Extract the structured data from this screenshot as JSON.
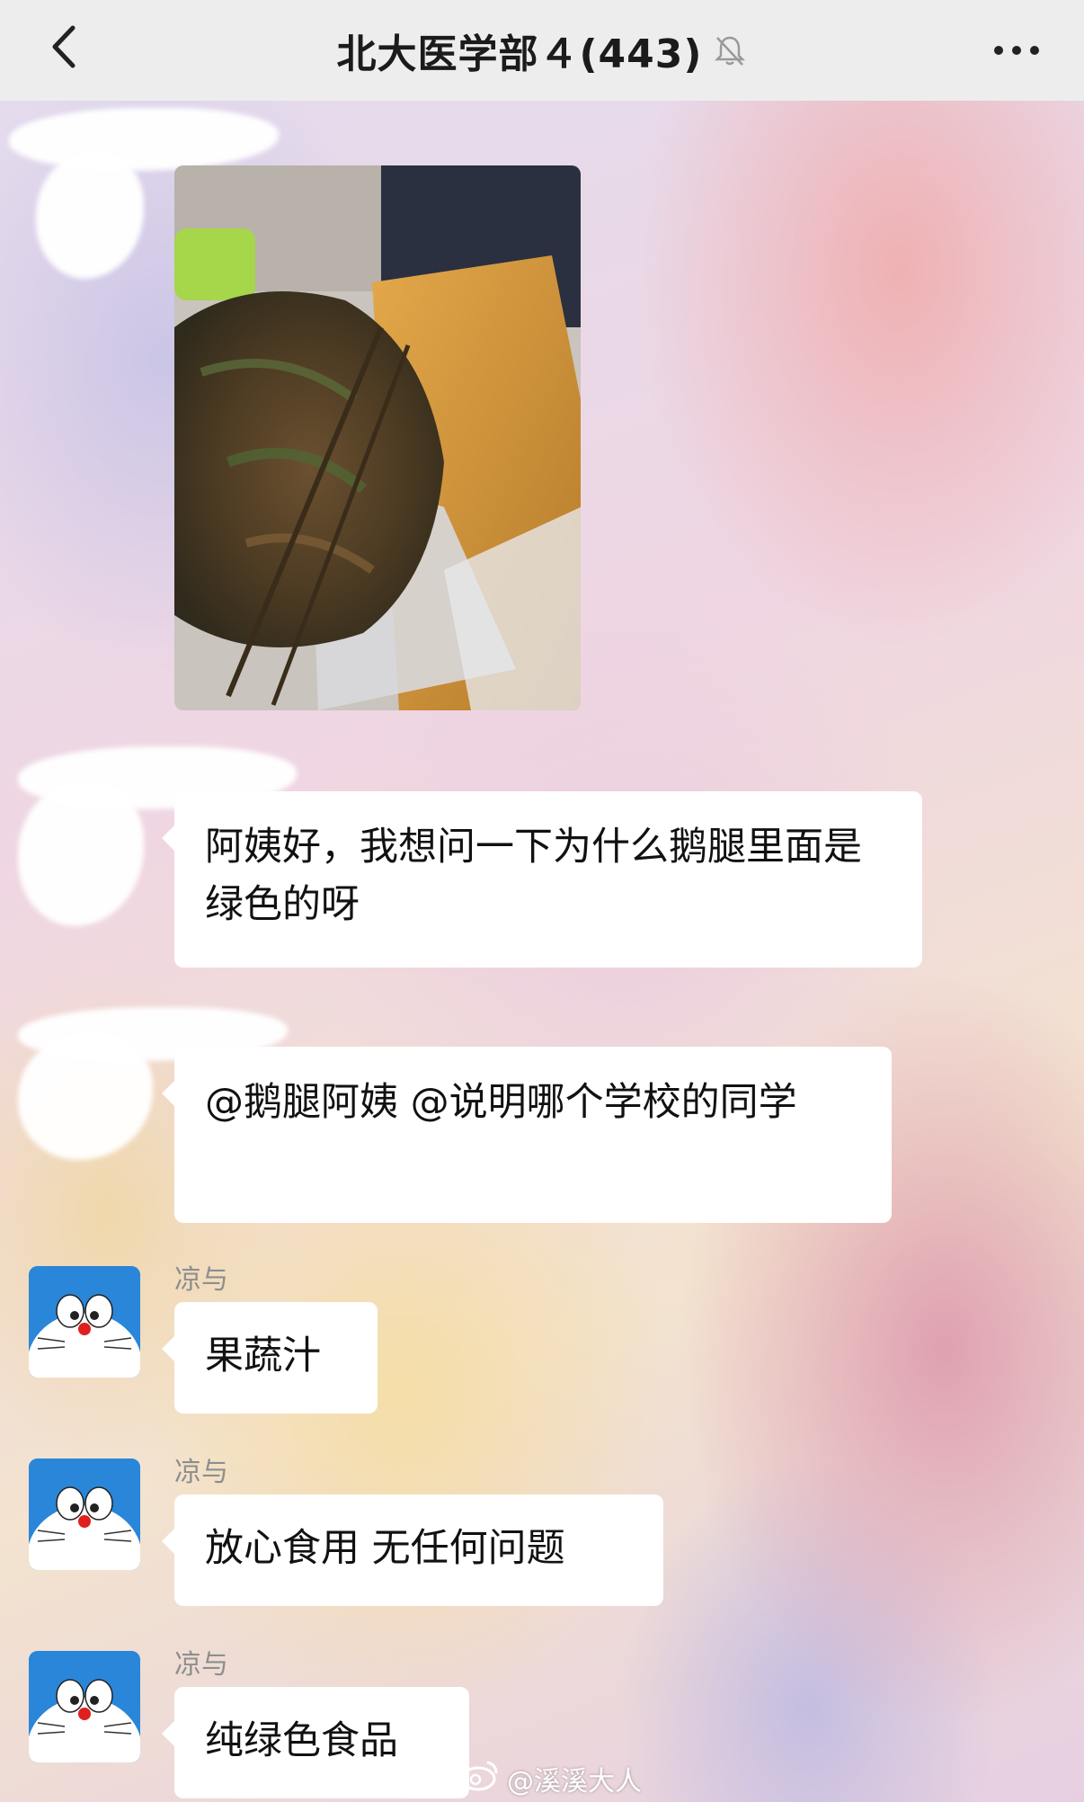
{
  "header": {
    "title": "北大医学部４(443)",
    "back_icon": "chevron-left-icon",
    "mute_icon": "bell-muted-icon",
    "more_icon": "more-dots-icon"
  },
  "messages": [
    {
      "type": "image",
      "sender_redacted": true,
      "image_desc": "goose-leg-photo"
    },
    {
      "type": "text",
      "sender_redacted": true,
      "text": "阿姨好，我想问一下为什么鹅腿里面是绿色的呀"
    },
    {
      "type": "text",
      "sender_redacted": true,
      "text": "@鹅腿阿姨 @说明哪个学校的同学"
    },
    {
      "type": "text",
      "sender": "凉与",
      "text": "果蔬汁"
    },
    {
      "type": "text",
      "sender": "凉与",
      "text": "放心食用 无任何问题"
    },
    {
      "type": "text",
      "sender": "凉与",
      "text": "纯绿色食品"
    }
  ],
  "watermark": {
    "text": "@溪溪大人",
    "icon": "weibo-icon"
  },
  "colors": {
    "header_bg": "#ededed",
    "bubble_bg": "#ffffff",
    "sender_name": "#8e8e8e",
    "avatar_bg": "#2a86d8"
  }
}
